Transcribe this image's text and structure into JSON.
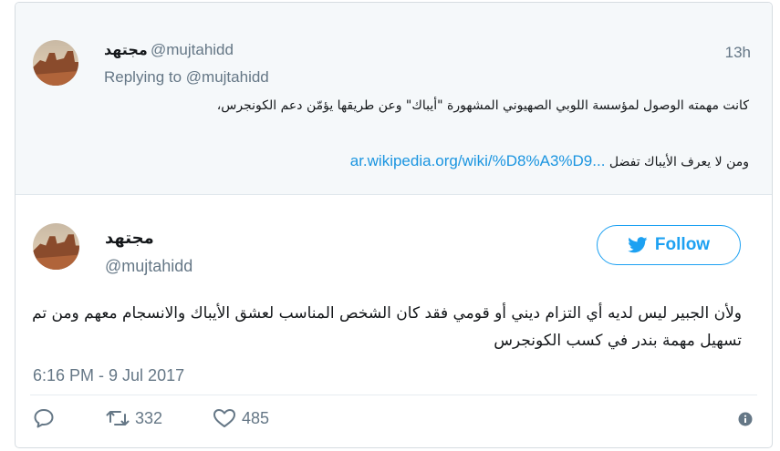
{
  "colors": {
    "accent": "#1da1f2",
    "link": "#1b95e0",
    "muted": "#657786",
    "parent_bg": "#f5f8fa"
  },
  "parent_tweet": {
    "display_name": "مجتهد",
    "handle": "@mujtahidd",
    "time": "13h",
    "replying_to_prefix": "Replying to ",
    "replying_to_handle": "@mujtahidd",
    "text_lines": [
      "كانت مهمته الوصول لمؤسسة اللوبي الصهيوني المشهورة \"أيباك\" وعن طريقها يؤمّن دعم الكونجرس،"
    ],
    "link_line_prefix": "ومن لا يعرف الأيباك تفضل",
    "link_text": "ar.wikipedia.org/wiki/%D8%A3%D9..."
  },
  "main_tweet": {
    "display_name": "مجتهد",
    "handle": "@mujtahidd",
    "follow_label": "Follow",
    "text": "ولأن الجبير ليس لديه أي التزام ديني أو قومي فقد كان الشخص المناسب لعشق الأيباك والانسجام معهم ومن تم تسهيل مهمة بندر في كسب الكونجرس",
    "date": "6:16 PM - 9 Jul 2017",
    "retweets": "332",
    "likes": "485"
  },
  "icons": [
    "reply-icon",
    "retweet-icon",
    "like-icon",
    "info-icon",
    "twitter-bird-icon"
  ]
}
